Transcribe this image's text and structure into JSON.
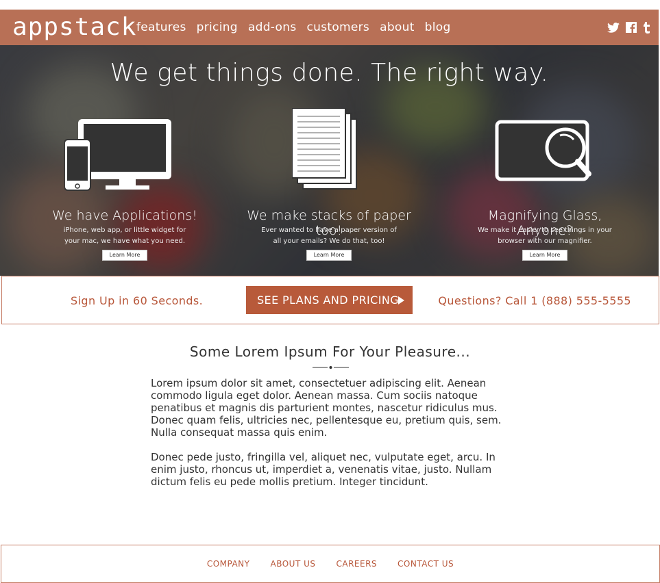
{
  "header": {
    "logo": "appstack",
    "nav": [
      "features",
      "pricing",
      "add-ons",
      "customers",
      "about",
      "blog"
    ],
    "social": [
      "twitter-icon",
      "facebook-icon",
      "tumblr-icon"
    ]
  },
  "hero": {
    "title": "We get things done. The right way.",
    "features": [
      {
        "icon": "devices-icon",
        "title": "We have Applications!",
        "text": "iPhone, web app, or little widget for your mac, we have what you need.",
        "button": "Learn More"
      },
      {
        "icon": "paper-stack-icon",
        "title": "We make stacks of paper too!",
        "text": "Ever wanted to have a paper version of all your emails? We do that, too!",
        "button": "Learn More"
      },
      {
        "icon": "magnifier-icon",
        "title": "Magnifying Glass, Anyone?",
        "text": "We make it easier to see things in your browser with our magnifier.",
        "button": "Learn More"
      }
    ]
  },
  "cta": {
    "left": "Sign Up in 60 Seconds.",
    "button": "SEE PLANS AND PRICING",
    "right": "Questions? Call 1 (888) 555-5555"
  },
  "content": {
    "title": "Some Lorem Ipsum For Your Pleasure...",
    "paragraphs": [
      "Lorem ipsum dolor sit amet, consectetuer adipiscing elit. Aenean commodo ligula eget dolor. Aenean massa. Cum sociis natoque penatibus et magnis dis parturient montes, nascetur ridiculus mus. Donec quam felis, ultricies nec, pellentesque eu, pretium quis, sem. Nulla consequat massa quis enim.",
      "Donec pede justo, fringilla vel, aliquet nec, vulputate eget, arcu. In enim justo, rhoncus ut, imperdiet a, venenatis vitae, justo. Nullam dictum felis eu pede mollis pretium. Integer tincidunt."
    ]
  },
  "footer": {
    "links": [
      "COMPANY",
      "ABOUT US",
      "CAREERS",
      "CONTACT US"
    ]
  },
  "colors": {
    "brand": "#b87056",
    "accent": "#b85a3a"
  }
}
